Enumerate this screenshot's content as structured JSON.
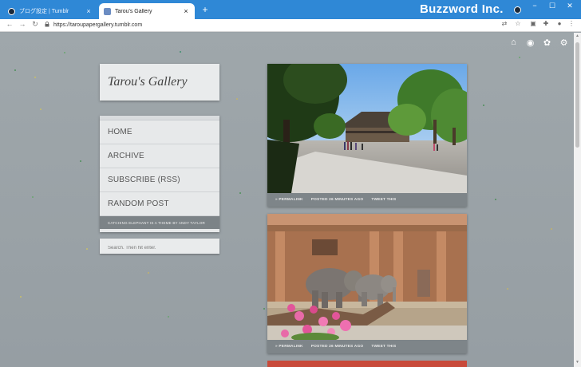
{
  "browser": {
    "tabs": [
      {
        "title": "ブログ設定 | Tumblr",
        "close": "×"
      },
      {
        "title": "Tarou's Gallery",
        "close": "×"
      }
    ],
    "new_tab": "+",
    "brand": "Buzzword Inc.",
    "window_controls": {
      "minimize": "−",
      "maximize": "☐",
      "close": "✕"
    },
    "toolbar": {
      "back": "←",
      "forward": "→",
      "reload": "↻",
      "lock": "🔒"
    },
    "url": "https://taroupapergallery.tumblr.com"
  },
  "page": {
    "site_title": "Tarou's Gallery",
    "menu": [
      "HOME",
      "ARCHIVE",
      "SUBSCRIBE (RSS)",
      "RANDOM POST"
    ],
    "theme_credit": "CATCHING ELEPHANT IS A THEME BY ANDY TAYLOR",
    "search_placeholder": "Search. Then hit enter.",
    "posts": [
      {
        "permalink": "» PERMALINK",
        "posted": "POSTED 26 MINUTES AGO",
        "tweet": "TWEET THIS"
      },
      {
        "permalink": "» PERMALINK",
        "posted": "POSTED 26 MINUTES AGO",
        "tweet": "TWEET THIS"
      }
    ]
  },
  "icons": [
    "home-icon",
    "eye-icon",
    "palette-icon",
    "gear-icon"
  ],
  "colors": {
    "titlebar": "#2f88d6",
    "page_background": "#9aa3a8",
    "panel": "#e9ebec",
    "post_footer": "#7e8589"
  }
}
